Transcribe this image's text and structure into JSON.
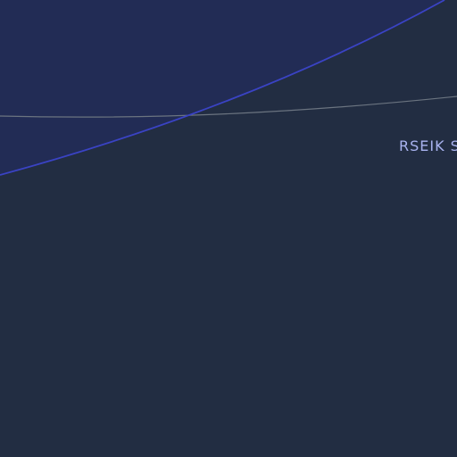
{
  "map": {
    "colors": {
      "background": "#222d42",
      "airspace_fill": "#222c55",
      "airspace_boundary": "#3a43c4",
      "secondary_line": "#6b7480",
      "label": "#a9b3f0"
    },
    "labels": [
      {
        "text": "RSEIK S"
      }
    ]
  }
}
